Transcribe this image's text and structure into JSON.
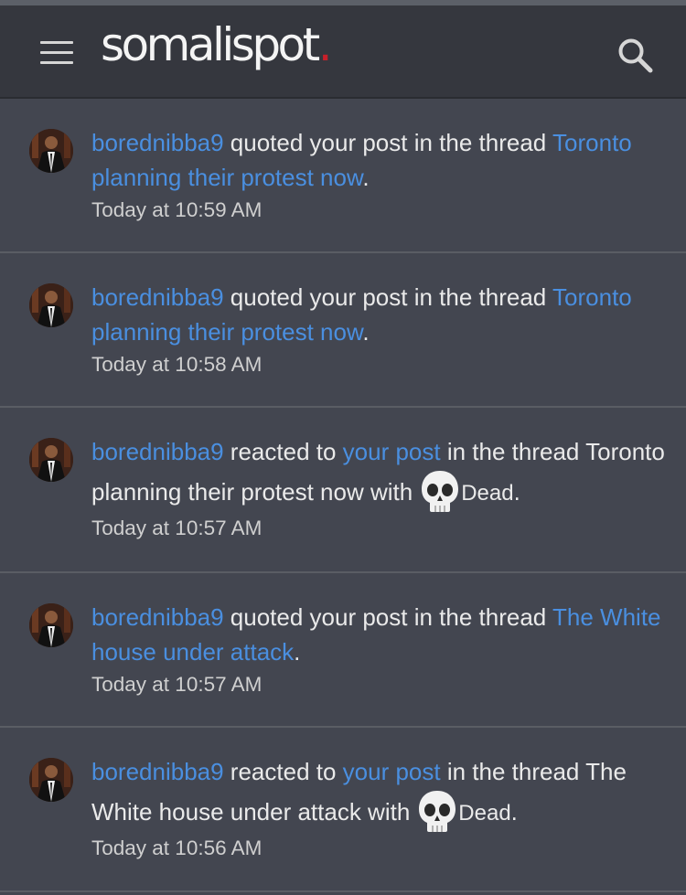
{
  "header": {
    "logo_text": "somalispot",
    "logo_dot": ".",
    "menu_icon": "hamburger-menu-icon",
    "search_icon": "search-icon"
  },
  "colors": {
    "background": "#434650",
    "header": "#35373e",
    "link": "#4a8fe0",
    "text": "#eaeaea",
    "logo_dot": "#c8202a"
  },
  "alerts": [
    {
      "user": "borednibba9",
      "action": " quoted your post in the thread ",
      "thread": "Toronto planning their protest now",
      "suffix": ".",
      "time": "Today at 10:59 AM"
    },
    {
      "user": "borednibba9",
      "action": " quoted your post in the thread ",
      "thread": "Toronto planning their protest now",
      "suffix": ".",
      "time": "Today at 10:58 AM"
    },
    {
      "user": "borednibba9",
      "action_pre": " reacted to ",
      "post_link": "your post",
      "action_post": " in the thread Toronto planning their protest now with",
      "reaction_icon": "skull-icon",
      "reaction": "Dead",
      "suffix": ".",
      "time": "Today at 10:57 AM"
    },
    {
      "user": "borednibba9",
      "action": " quoted your post in the thread ",
      "thread": "The White house under attack",
      "suffix": ".",
      "time": "Today at 10:57 AM"
    },
    {
      "user": "borednibba9",
      "action_pre": " reacted to ",
      "post_link": "your post",
      "action_post": " in the thread The White house under attack with",
      "reaction_icon": "skull-icon",
      "reaction": "Dead",
      "suffix": ".",
      "time": "Today at 10:56 AM"
    }
  ]
}
